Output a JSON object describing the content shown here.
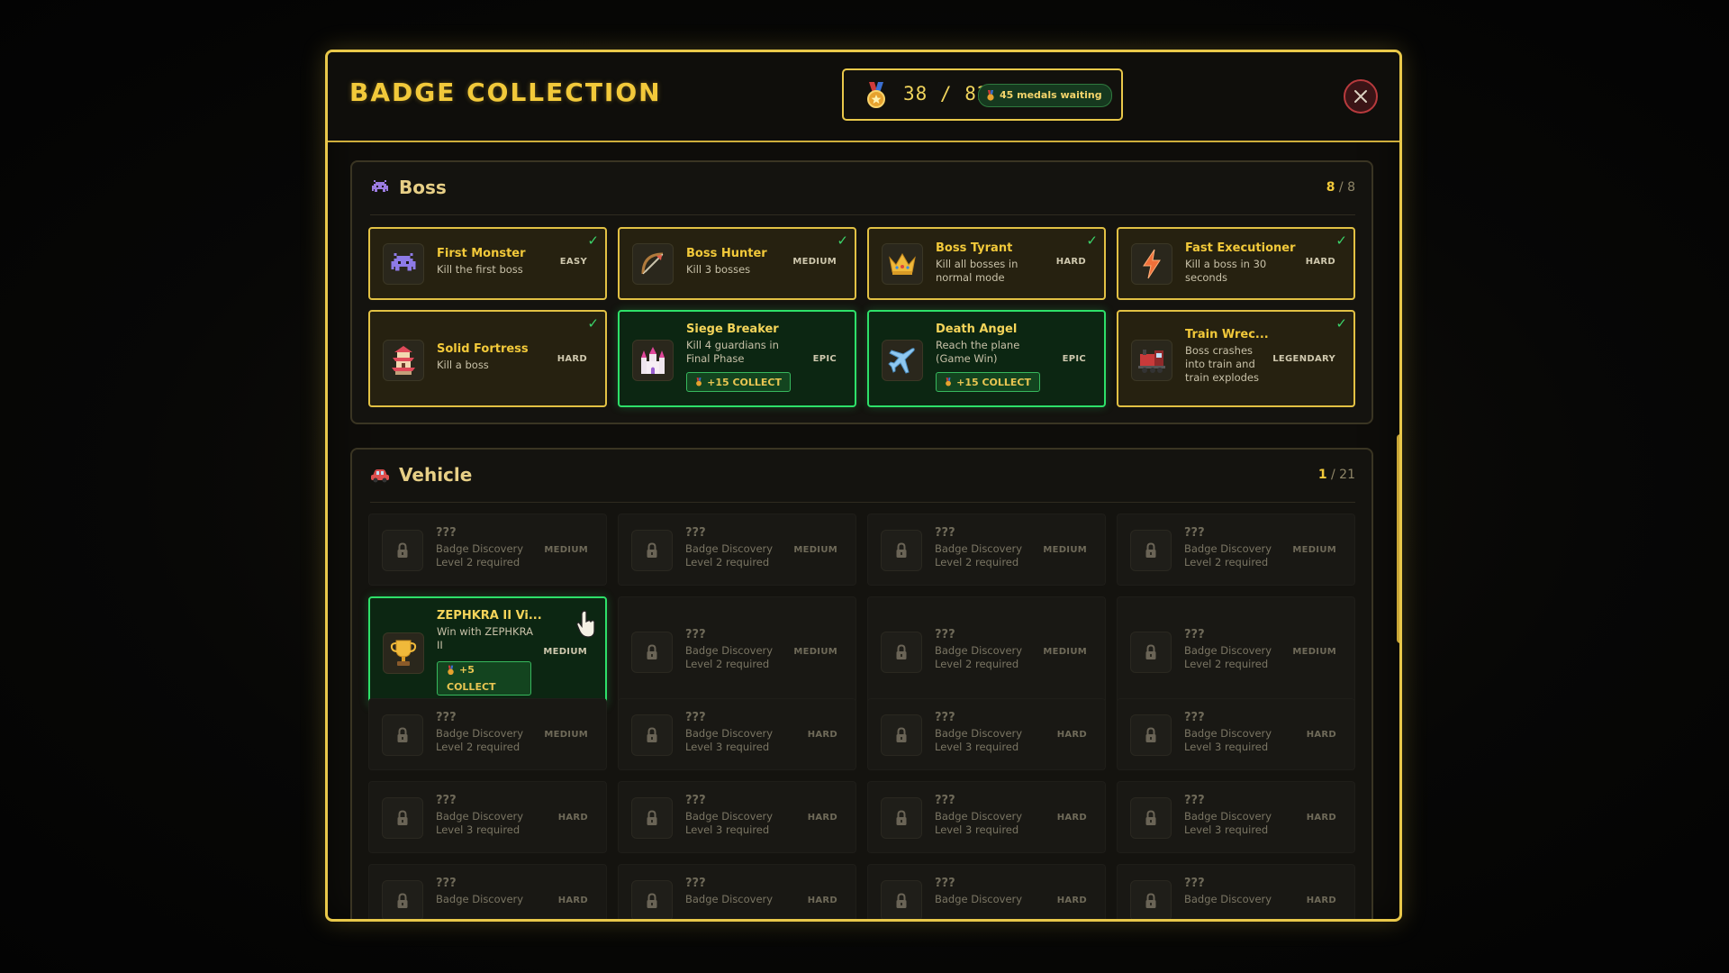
{
  "modal": {
    "title": "BADGE COLLECTION",
    "progress": "38 / 82",
    "pending": "45 medals waiting"
  },
  "colors": {
    "accent": "#f2c93a",
    "ready": "#2ee069",
    "close": "#b83a3d"
  },
  "sections": [
    {
      "name": "Boss",
      "icon": "invader-icon",
      "count_done": "8",
      "count_total": "/ 8",
      "cards": [
        {
          "title": "First Monster",
          "desc": "Kill the first boss",
          "difficulty": "EASY",
          "status": "done",
          "icon": "invader-icon"
        },
        {
          "title": "Boss Hunter",
          "desc": "Kill 3 bosses",
          "difficulty": "MEDIUM",
          "status": "done",
          "icon": "bow-icon"
        },
        {
          "title": "Boss Tyrant",
          "desc": "Kill all bosses in normal mode",
          "difficulty": "HARD",
          "status": "done",
          "icon": "crown-icon"
        },
        {
          "title": "Fast Executioner",
          "desc": "Kill a boss in 30 seconds",
          "difficulty": "HARD",
          "status": "done",
          "icon": "lightning-icon"
        },
        {
          "title": "Solid Fortress",
          "desc": "Kill a boss",
          "difficulty": "HARD",
          "status": "done",
          "icon": "pagoda-icon"
        },
        {
          "title": "Siege Breaker",
          "desc": "Kill 4 guardians in Final Phase",
          "difficulty": "EPIC",
          "status": "ready",
          "collect": "+15 COLLECT",
          "icon": "castle-icon"
        },
        {
          "title": "Death Angel",
          "desc": "Reach the plane (Game Win)",
          "difficulty": "EPIC",
          "status": "ready",
          "collect": "+15 COLLECT",
          "icon": "airplane-icon"
        },
        {
          "title": "Train Wrec...",
          "desc": "Boss crashes into train and train explodes",
          "difficulty": "LEGENDARY",
          "status": "done",
          "icon": "train-icon"
        }
      ]
    },
    {
      "name": "Vehicle",
      "icon": "car-icon",
      "count_done": "1",
      "count_total": "/ 21",
      "cards": [
        {
          "title": "???",
          "desc": "Badge Discovery Level 2 required",
          "difficulty": "MEDIUM",
          "status": "locked"
        },
        {
          "title": "???",
          "desc": "Badge Discovery Level 2 required",
          "difficulty": "MEDIUM",
          "status": "locked"
        },
        {
          "title": "???",
          "desc": "Badge Discovery Level 2 required",
          "difficulty": "MEDIUM",
          "status": "locked"
        },
        {
          "title": "???",
          "desc": "Badge Discovery Level 2 required",
          "difficulty": "MEDIUM",
          "status": "locked"
        },
        {
          "title": "ZEPHKRA II Vi...",
          "desc": "Win with ZEPHKRA II",
          "difficulty": "MEDIUM",
          "status": "ready",
          "collect_a": "+5",
          "collect_b": "COLLECT",
          "icon": "trophy-icon"
        },
        {
          "title": "???",
          "desc": "Badge Discovery Level 2 required",
          "difficulty": "MEDIUM",
          "status": "locked"
        },
        {
          "title": "???",
          "desc": "Badge Discovery Level 2 required",
          "difficulty": "MEDIUM",
          "status": "locked"
        },
        {
          "title": "???",
          "desc": "Badge Discovery Level 2 required",
          "difficulty": "MEDIUM",
          "status": "locked"
        },
        {
          "title": "???",
          "desc": "Badge Discovery Level 2 required",
          "difficulty": "MEDIUM",
          "status": "locked"
        },
        {
          "title": "???",
          "desc": "Badge Discovery Level 3 required",
          "difficulty": "HARD",
          "status": "locked"
        },
        {
          "title": "???",
          "desc": "Badge Discovery Level 3 required",
          "difficulty": "HARD",
          "status": "locked"
        },
        {
          "title": "???",
          "desc": "Badge Discovery Level 3 required",
          "difficulty": "HARD",
          "status": "locked"
        },
        {
          "title": "???",
          "desc": "Badge Discovery Level 3 required",
          "difficulty": "HARD",
          "status": "locked"
        },
        {
          "title": "???",
          "desc": "Badge Discovery Level 3 required",
          "difficulty": "HARD",
          "status": "locked"
        },
        {
          "title": "???",
          "desc": "Badge Discovery Level 3 required",
          "difficulty": "HARD",
          "status": "locked"
        },
        {
          "title": "???",
          "desc": "Badge Discovery Level 3 required",
          "difficulty": "HARD",
          "status": "locked"
        },
        {
          "title": "???",
          "desc": "Badge Discovery",
          "difficulty": "HARD",
          "status": "locked"
        },
        {
          "title": "???",
          "desc": "Badge Discovery",
          "difficulty": "HARD",
          "status": "locked"
        },
        {
          "title": "???",
          "desc": "Badge Discovery",
          "difficulty": "HARD",
          "status": "locked"
        },
        {
          "title": "???",
          "desc": "Badge Discovery",
          "difficulty": "HARD",
          "status": "locked"
        }
      ]
    }
  ]
}
